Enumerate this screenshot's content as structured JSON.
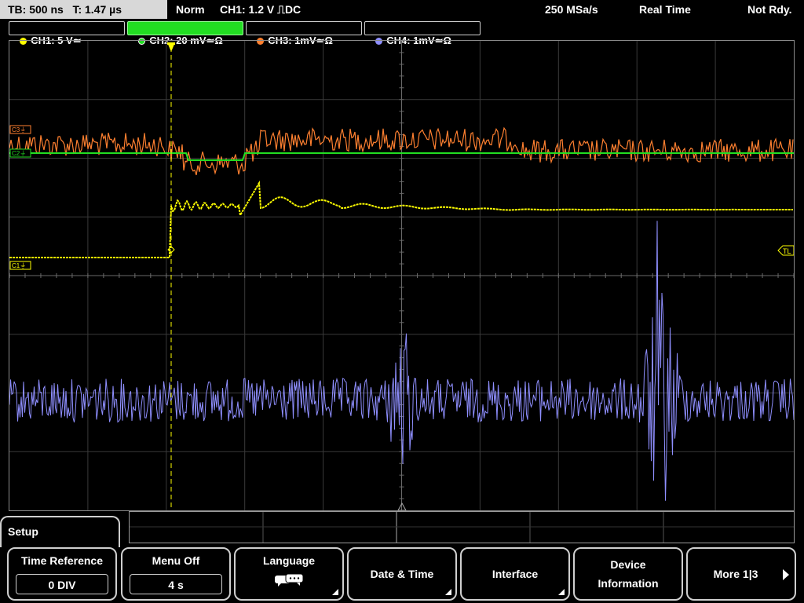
{
  "status": {
    "timebase": "TB: 500 ns   T: 1.47 µs",
    "mode": "Norm",
    "trigger": "CH1: 1.2 V ⎍DC",
    "sample_rate": "250 MSa/s",
    "acq": "Real Time",
    "ready": "Not Rdy."
  },
  "channels": [
    {
      "label": "CH1: 5 V≃",
      "color": "#ffff00"
    },
    {
      "label": "CH2: 20 mV≃Ω",
      "color": "#22dd22"
    },
    {
      "label": "CH3: 1mV≃Ω",
      "color": "#ff8030"
    },
    {
      "label": "CH4: 1mV≃Ω",
      "color": "#8f8fff"
    }
  ],
  "markers": {
    "ch1": "C1⏚",
    "ch2": "C2⏚",
    "ch3": "C3⏚",
    "trigger_level": "TL"
  },
  "menu": {
    "title": "Setup",
    "softkeys": [
      {
        "label": "Time Reference",
        "value": "0 DIV"
      },
      {
        "label": "Menu Off",
        "value": "4 s"
      },
      {
        "label": "Language",
        "icon": "speech-bubbles-icon"
      },
      {
        "label": "Date & Time"
      },
      {
        "label": "Interface"
      },
      {
        "label": "Device Information"
      },
      {
        "label": "More 1|3"
      }
    ]
  }
}
